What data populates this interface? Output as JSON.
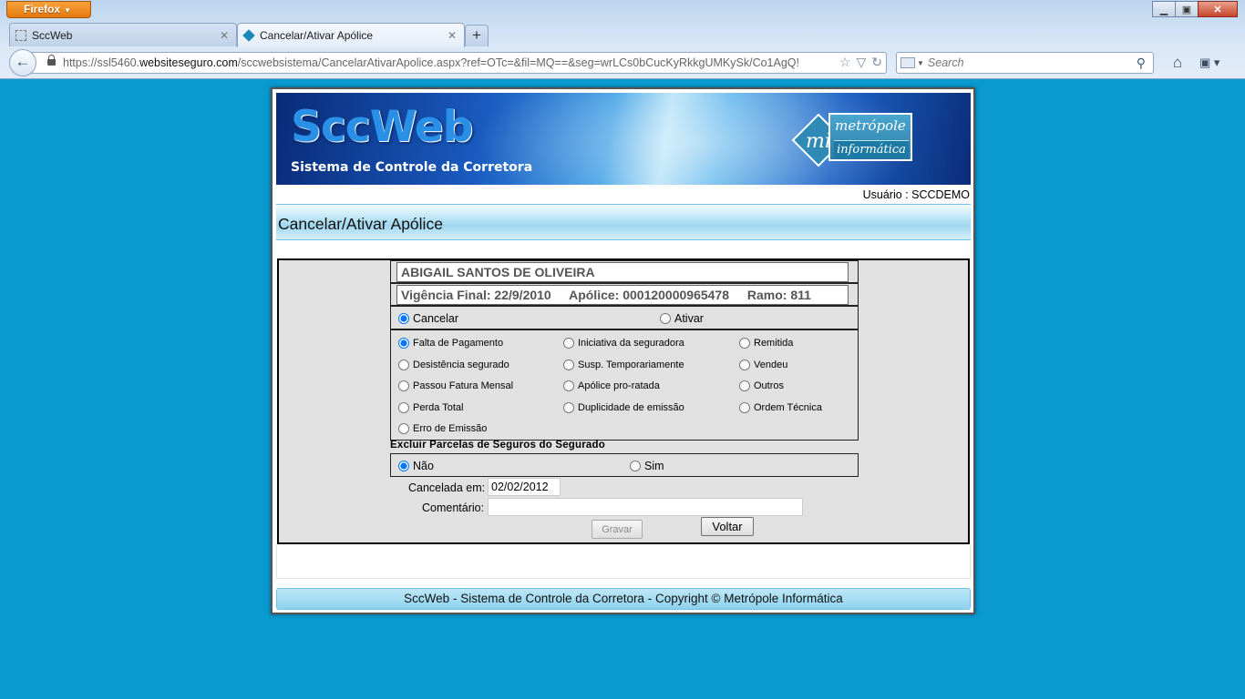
{
  "browser": {
    "menu_button": "Firefox",
    "tabs": [
      {
        "title": "SccWeb"
      },
      {
        "title": "Cancelar/Ativar Apólice"
      }
    ],
    "url_prefix": "https://ssl5460.",
    "url_domain": "websiteseguro.com",
    "url_rest": "/sccwebsistema/CancelarAtivarApolice.aspx?ref=OTc=&fil=MQ==&seg=wrLCs0bCucKyRkkgUMKySk/Co1AgQ!",
    "search_placeholder": "Search"
  },
  "banner": {
    "title": "SccWeb",
    "subtitle": "Sistema de Controle da Corretora",
    "logo_monogram": "mi",
    "logo_line1": "metrópole",
    "logo_line2": "informática"
  },
  "user_label": "Usuário : SCCDEMO",
  "page_title": "Cancelar/Ativar Apólice",
  "policy": {
    "holder_name": "ABIGAIL SANTOS DE OLIVEIRA",
    "vigencia": "Vigência Final: 22/9/2010",
    "apolice": "Apólice: 000120000965478",
    "ramo": "Ramo: 811"
  },
  "action": {
    "options": [
      "Cancelar",
      "Ativar"
    ],
    "selected": "Cancelar"
  },
  "reasons": {
    "options": [
      "Falta de Pagamento",
      "Iniciativa da seguradora",
      "Remitida",
      "Desistência segurado",
      "Susp. Temporariamente",
      "Vendeu",
      "Passou Fatura Mensal",
      "Apólice pro-ratada",
      "Outros",
      "Perda Total",
      "Duplicidade de emissão",
      "Ordem Técnica",
      "Erro de Emissão"
    ],
    "selected": "Falta de Pagamento"
  },
  "parcels": {
    "heading": "Excluir Parcelas de Seguros do Segurado",
    "options": [
      "Não",
      "Sim"
    ],
    "selected": "Não"
  },
  "form": {
    "cancel_date_label": "Cancelada em:",
    "cancel_date_value": "02/02/2012",
    "comment_label": "Comentário:",
    "comment_value": "",
    "save_label": "Gravar",
    "back_label": "Voltar"
  },
  "footer": "SccWeb - Sistema de Controle da Corretora - Copyright © Metrópole Informática",
  "colors": {
    "desktop_bg": "#0a9ad0",
    "form_bg": "#e1e1e1",
    "title_bar": "#9fd6ef"
  }
}
